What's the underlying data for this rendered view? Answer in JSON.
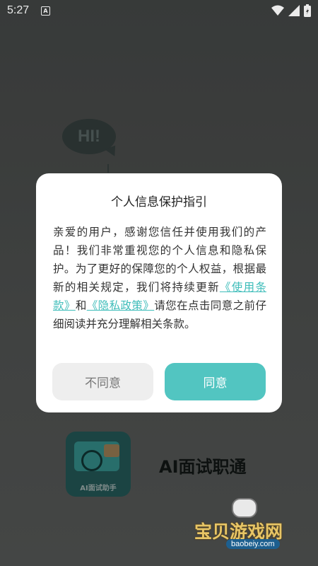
{
  "status_bar": {
    "time": "5:27",
    "indicator": "A"
  },
  "background": {
    "bubble_text": "HI!",
    "logo_caption": "AI面试助手",
    "app_name": "AI面试职通"
  },
  "dialog": {
    "title": "个人信息保护指引",
    "body_pre": "亲爱的用户，感谢您信任并使用我们的产品！我们非常重视您的个人信息和隐私保护。为了更好的保障您的个人权益，根据最新的相关规定，我们将持续更新",
    "link_terms": "《使用条款》",
    "connector": "和",
    "link_privacy": "《隐私政策》",
    "body_post": "请您在点击同意之前仔细阅读并充分理解相关条款。",
    "disagree_label": "不同意",
    "agree_label": "同意"
  },
  "watermark": {
    "text": "宝贝游戏网",
    "url": "baobeiy.com"
  },
  "colors": {
    "accent": "#52c5c1",
    "link": "#3fbdba",
    "disagree_bg": "#eeeeee"
  }
}
